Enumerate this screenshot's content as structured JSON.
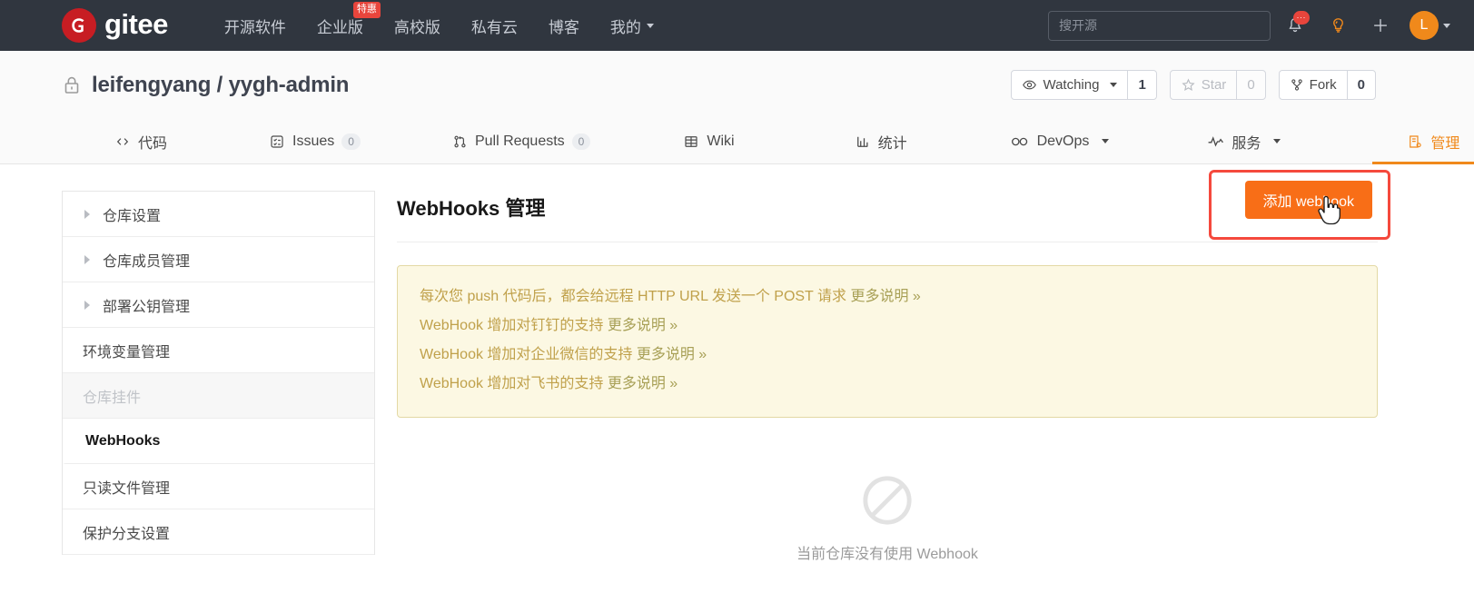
{
  "topbar": {
    "logo_text": "gitee",
    "logo_icon": "gitee-logo-icon",
    "nav": [
      {
        "label": "开源软件",
        "badge": null
      },
      {
        "label": "企业版",
        "badge": "特惠"
      },
      {
        "label": "高校版",
        "badge": null
      },
      {
        "label": "私有云",
        "badge": null
      },
      {
        "label": "博客",
        "badge": null
      },
      {
        "label": "我的",
        "badge": null,
        "has_caret": true
      }
    ],
    "search": {
      "placeholder": "搜开源",
      "value": ""
    },
    "notification_badge": "···",
    "avatar_letter": "L",
    "icons": [
      "bell-icon",
      "lightbulb-icon",
      "plus-icon",
      "avatar"
    ]
  },
  "repo": {
    "visibility_icon": "lock-icon",
    "owner": "leifengyang",
    "separator": "/",
    "name": "yygh-admin",
    "full_title": "leifengyang / yygh-admin",
    "actions": [
      {
        "name": "watching",
        "icon": "eye-icon",
        "label": "Watching",
        "caret": true,
        "count": "1",
        "disabled": false
      },
      {
        "name": "star",
        "icon": "star-icon",
        "label": "Star",
        "caret": false,
        "count": "0",
        "disabled": true
      },
      {
        "name": "fork",
        "icon": "fork-icon",
        "label": "Fork",
        "caret": false,
        "count": "0",
        "disabled": false
      }
    ]
  },
  "tabs": [
    {
      "id": "code",
      "icon": "code-icon",
      "label": "代码",
      "count": null,
      "active": false,
      "caret": false
    },
    {
      "id": "issues",
      "icon": "issues-icon",
      "label": "Issues",
      "count": "0",
      "active": false,
      "caret": false
    },
    {
      "id": "pull-requests",
      "icon": "pull-request-icon",
      "label": "Pull Requests",
      "count": "0",
      "active": false,
      "caret": false
    },
    {
      "id": "wiki",
      "icon": "book-icon",
      "label": "Wiki",
      "count": null,
      "active": false,
      "caret": false
    },
    {
      "id": "stats",
      "icon": "chart-icon",
      "label": "统计",
      "count": null,
      "active": false,
      "caret": false
    },
    {
      "id": "devops",
      "icon": "infinity-icon",
      "label": "DevOps",
      "count": null,
      "active": false,
      "caret": true
    },
    {
      "id": "service",
      "icon": "pulse-icon",
      "label": "服务",
      "count": null,
      "active": false,
      "caret": true
    },
    {
      "id": "manage",
      "icon": "manage-icon",
      "label": "管理",
      "count": null,
      "active": true,
      "caret": false
    }
  ],
  "sidebar": {
    "items": [
      {
        "label": "仓库设置",
        "expandable": true,
        "state": "normal"
      },
      {
        "label": "仓库成员管理",
        "expandable": true,
        "state": "normal"
      },
      {
        "label": "部署公钥管理",
        "expandable": true,
        "state": "normal"
      },
      {
        "label": "环境变量管理",
        "expandable": false,
        "state": "normal"
      },
      {
        "label": "仓库挂件",
        "expandable": false,
        "state": "muted"
      },
      {
        "label": "WebHooks",
        "expandable": false,
        "state": "active"
      },
      {
        "label": "只读文件管理",
        "expandable": false,
        "state": "normal"
      },
      {
        "label": "保护分支设置",
        "expandable": false,
        "state": "normal"
      }
    ]
  },
  "main": {
    "title": "WebHooks 管理",
    "add_button_label": "添加 webhook",
    "notice": [
      {
        "text": "每次您 push 代码后，都会给远程 HTTP URL 发送一个 POST 请求 ",
        "link": "更多说明 »"
      },
      {
        "text": "WebHook 增加对钉钉的支持 ",
        "link": "更多说明 »"
      },
      {
        "text": "WebHook 增加对企业微信的支持 ",
        "link": "更多说明 »"
      },
      {
        "text": "WebHook 增加对飞书的支持 ",
        "link": "更多说明 »"
      }
    ],
    "empty_icon": "no-entry-icon",
    "empty_text": "当前仓库没有使用 Webhook"
  },
  "colors": {
    "topbar_bg": "#30363f",
    "accent_orange": "#f0891b",
    "button_orange": "#f86e17",
    "highlight_red": "#f5493d",
    "logo_red": "#c71d23",
    "notice_bg": "#fcf8e3",
    "notice_border": "#e3d9a5",
    "notice_text": "#c0a14b"
  }
}
